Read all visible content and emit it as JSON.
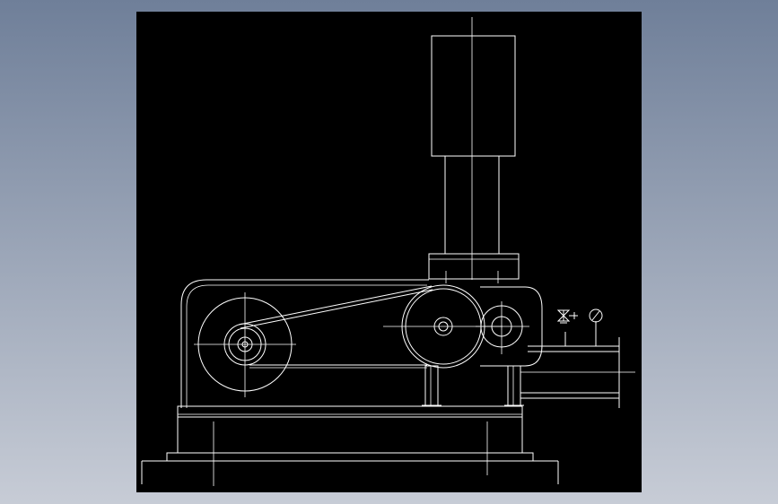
{
  "viewport": {
    "background_top": "#6f7f99",
    "background_bottom": "#c7ccd6"
  },
  "canvas": {
    "background": "#000000",
    "line_color": "#ffffff"
  },
  "drawing": {
    "icons": [
      "pressure-valve-symbol-icon",
      "pressure-gauge-symbol-icon"
    ]
  }
}
